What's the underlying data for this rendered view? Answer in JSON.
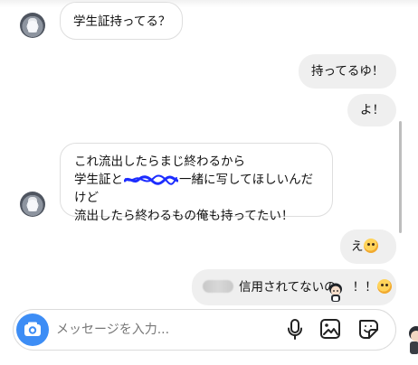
{
  "thread": {
    "messages": [
      {
        "id": "m1",
        "direction": "incoming",
        "lines": [
          "学生証持ってる？"
        ]
      },
      {
        "id": "m2",
        "direction": "outgoing",
        "lines": [
          "持ってるゆ！"
        ]
      },
      {
        "id": "m3",
        "direction": "outgoing",
        "lines": [
          "よ！"
        ]
      },
      {
        "id": "m4",
        "direction": "incoming",
        "lines": [
          "これ流出したらまじ終わるから",
          "学生証と",
          "一緒に写してほしいんだけど",
          "流出したら終わるもの俺も持ってたい！"
        ]
      },
      {
        "id": "m5",
        "direction": "outgoing",
        "text": "え",
        "emoji": "pleading-face"
      },
      {
        "id": "m6",
        "direction": "outgoing",
        "text": "信用されてないの",
        "suffix": "！！",
        "emoji": "sad-face"
      }
    ]
  },
  "composer": {
    "placeholder": "メッセージを入力...",
    "icons": {
      "camera": "camera-icon",
      "mic": "microphone-icon",
      "photo": "image-icon",
      "sticker": "sticker-icon"
    }
  },
  "colors": {
    "accent": "#3d8df5",
    "incoming_border": "#dedede",
    "outgoing_bg": "#efefef",
    "scribble": "#1c2cff"
  }
}
